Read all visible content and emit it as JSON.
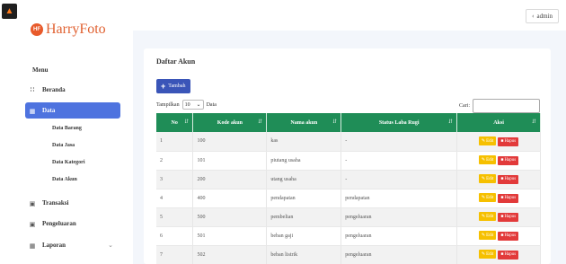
{
  "topbar": {
    "user_label": "admin"
  },
  "brand": {
    "badge": "HF",
    "name": "HarryFoto"
  },
  "sidebar": {
    "heading": "Menu",
    "items": [
      {
        "label": "Beranda",
        "icon": "grid-icon"
      },
      {
        "label": "Data",
        "icon": "table-icon"
      },
      {
        "label": "Transaksi",
        "icon": "file-icon"
      },
      {
        "label": "Pengeluaran",
        "icon": "file-icon"
      },
      {
        "label": "Laporan",
        "icon": "table-icon"
      }
    ],
    "sub_items": [
      "Data Barang",
      "Data Jasa",
      "Data Kategori",
      "Data Akun"
    ]
  },
  "main": {
    "title": "Daftar Akun",
    "add_label": "Tambah",
    "length_prefix": "Tampilkan",
    "length_value": "10",
    "length_suffix": "Data",
    "search_label": "Cari:",
    "columns": [
      "No",
      "Kode akun",
      "Nama akun",
      "Status Laba Rugi",
      "Aksi"
    ],
    "edit_label": "Edit",
    "delete_label": "Hapus",
    "rows": [
      {
        "no": "1",
        "kode": "100",
        "nama": "kas",
        "status": "-"
      },
      {
        "no": "2",
        "kode": "101",
        "nama": "piutang usaha",
        "status": "-"
      },
      {
        "no": "3",
        "kode": "200",
        "nama": "utang usaha",
        "status": "-"
      },
      {
        "no": "4",
        "kode": "400",
        "nama": "pendapatan",
        "status": "pendapatan"
      },
      {
        "no": "5",
        "kode": "500",
        "nama": "pembelian",
        "status": "pengeluaran"
      },
      {
        "no": "6",
        "kode": "501",
        "nama": "beban gaji",
        "status": "pengeluaran"
      },
      {
        "no": "7",
        "kode": "502",
        "nama": "beban listrik",
        "status": "pengeluaran"
      }
    ]
  },
  "colors": {
    "primary": "#4e73df",
    "table_header": "#1f8d57",
    "edit": "#f6c000",
    "delete": "#e23a3a"
  }
}
